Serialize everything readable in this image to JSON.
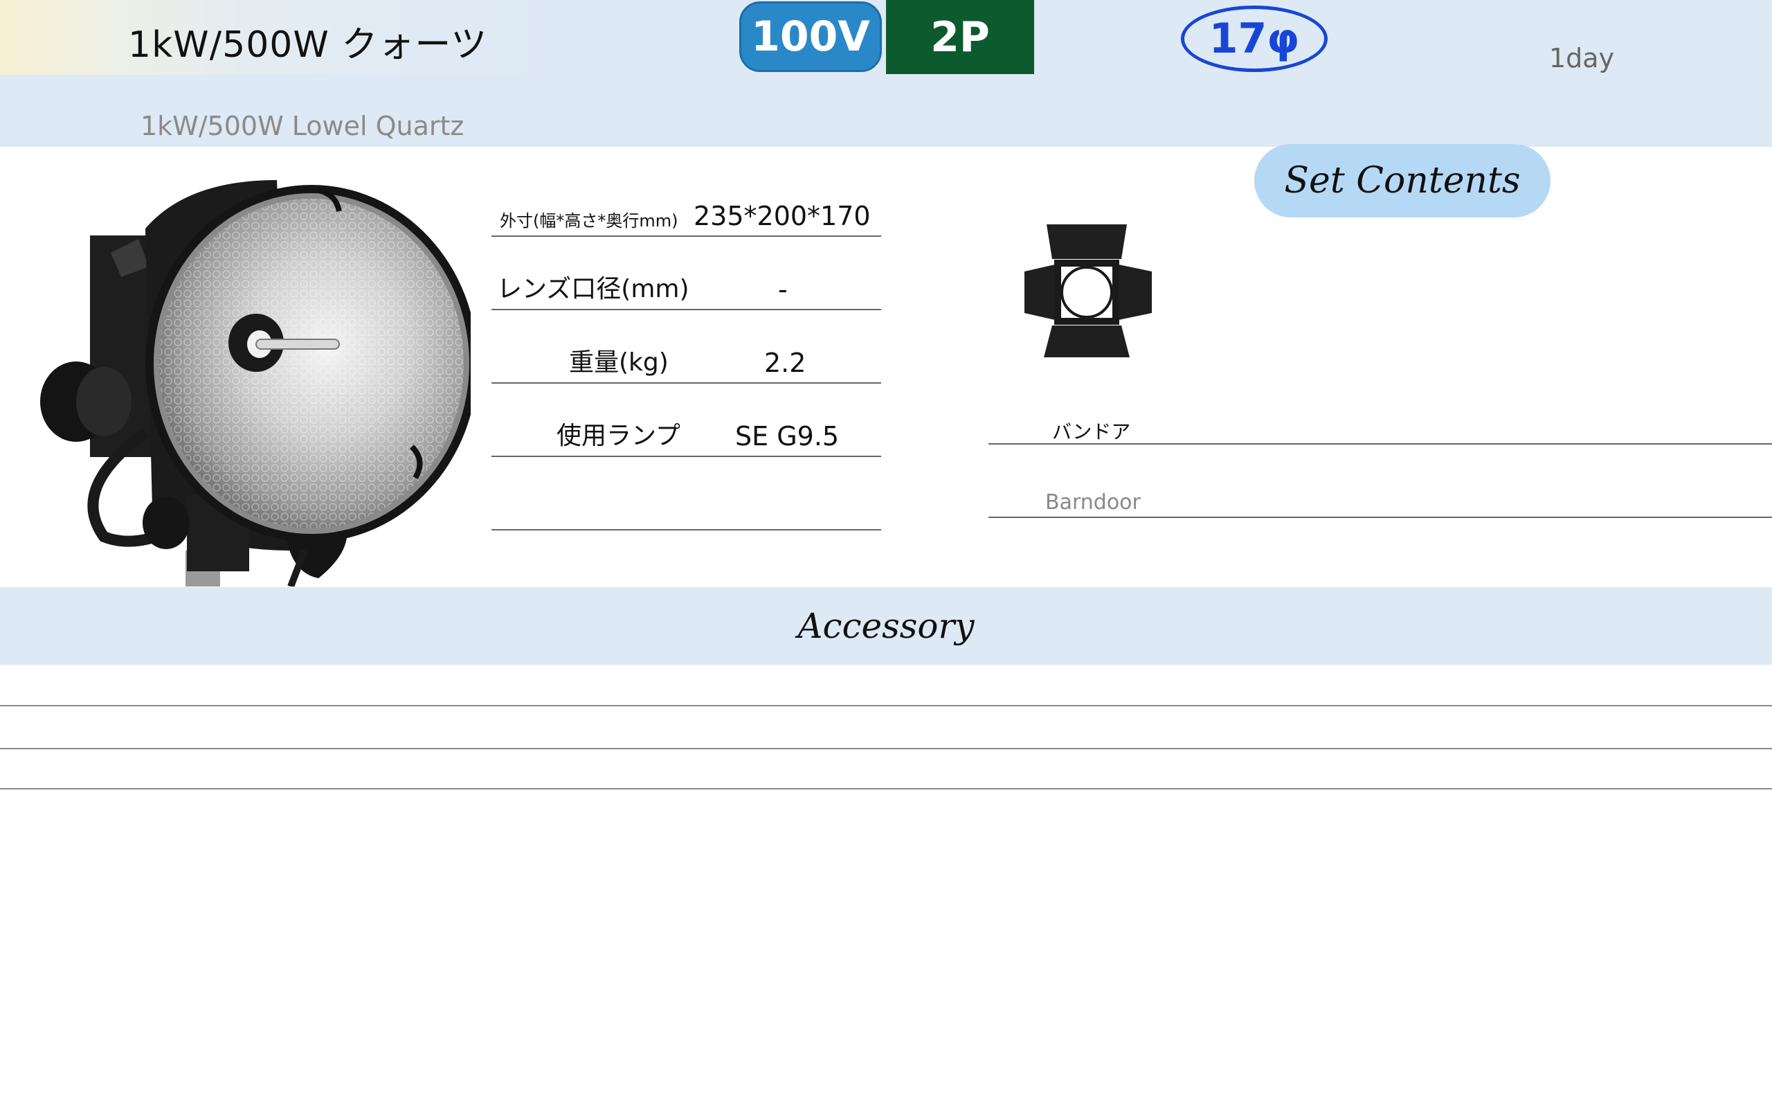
{
  "header": {
    "title_jp": "1kW/500W クォーツ",
    "title_en": "1kW/500W Lowel Quartz",
    "voltage_badge": "100V",
    "plug_badge": "2P",
    "diameter_badge": "17φ",
    "rental_period": "1day"
  },
  "specs": [
    {
      "label": "外寸(幅*高さ*奥行mm)",
      "value": "235*200*170"
    },
    {
      "label": "レンズ口径(mm)",
      "value": "-"
    },
    {
      "label": "重量(kg)",
      "value": "2.2"
    },
    {
      "label": "使用ランプ",
      "value": "SE G9.5"
    },
    {
      "label": "",
      "value": ""
    }
  ],
  "set_contents": {
    "title": "Set Contents",
    "items": [
      {
        "name_jp": "バンドア",
        "name_en": "Barndoor",
        "icon": "barndoor-icon"
      }
    ]
  },
  "accessory": {
    "title": "Accessory",
    "rows": [
      "",
      "",
      ""
    ]
  },
  "colors": {
    "band": "#dde9f5",
    "voltage_blue": "#2b88c8",
    "plug_green": "#0d5a2e",
    "diameter_blue": "#1746d6",
    "set_pill": "#b5d8f5"
  }
}
